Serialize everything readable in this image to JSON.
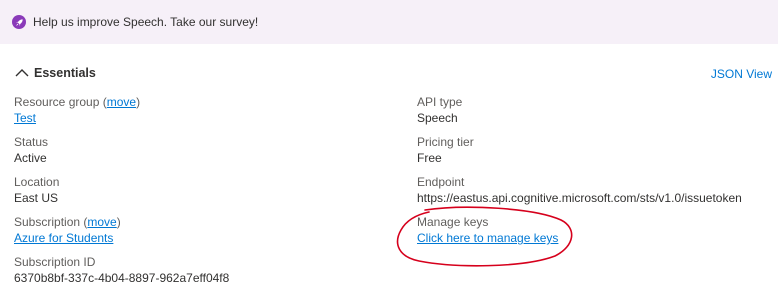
{
  "banner": {
    "text": "Help us improve Speech. Take our survey!",
    "icon": "rocket-icon",
    "icon_color": "#8a3ab9",
    "background": "#f6f0f8"
  },
  "essentials": {
    "title": "Essentials",
    "json_view_label": "JSON View"
  },
  "left": {
    "resource_group_label": "Resource group",
    "resource_group_move": "move",
    "resource_group_value": "Test",
    "status_label": "Status",
    "status_value": "Active",
    "location_label": "Location",
    "location_value": "East US",
    "subscription_label": "Subscription",
    "subscription_move": "move",
    "subscription_value": "Azure for Students",
    "subscription_id_label": "Subscription ID",
    "subscription_id_value": "6370b8bf-337c-4b04-8897-962a7eff04f8"
  },
  "right": {
    "api_type_label": "API type",
    "api_type_value": "Speech",
    "pricing_tier_label": "Pricing tier",
    "pricing_tier_value": "Free",
    "endpoint_label": "Endpoint",
    "endpoint_value": "https://eastus.api.cognitive.microsoft.com/sts/v1.0/issuetoken",
    "manage_keys_label": "Manage keys",
    "manage_keys_link": "Click here to manage keys"
  },
  "colors": {
    "link": "#0078d4",
    "annotation": "#d6001c"
  }
}
